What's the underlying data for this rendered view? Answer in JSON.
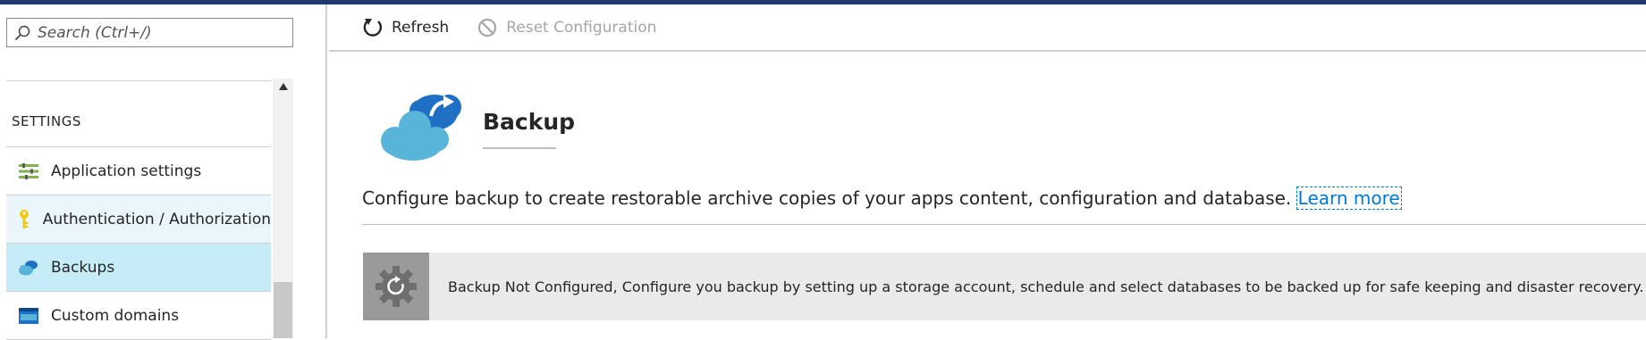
{
  "search": {
    "placeholder": "Search (Ctrl+/)"
  },
  "sidebar": {
    "section_label": "SETTINGS",
    "items": [
      {
        "label": "Application settings",
        "icon": "app-settings-icon",
        "state": "normal"
      },
      {
        "label": "Authentication / Authorization",
        "icon": "key-icon",
        "state": "hover"
      },
      {
        "label": "Backups",
        "icon": "backup-cloud-icon",
        "state": "active"
      },
      {
        "label": "Custom domains",
        "icon": "www-icon",
        "state": "normal"
      }
    ]
  },
  "toolbar": {
    "refresh_label": "Refresh",
    "reset_label": "Reset Configuration"
  },
  "main": {
    "title": "Backup",
    "description": "Configure backup to create restorable archive copies of your apps content, configuration and database.",
    "learn_more": "Learn more",
    "banner_text": "Backup Not Configured, Configure you backup by setting up a storage account, schedule and select databases to be backed up for safe keeping and disaster recovery."
  },
  "colors": {
    "topbar": "#1e3a6e",
    "active_item": "#c6ecf8",
    "hover_item": "#eaf6fb",
    "link": "#0078d4",
    "banner_bg": "#eaeaea"
  }
}
